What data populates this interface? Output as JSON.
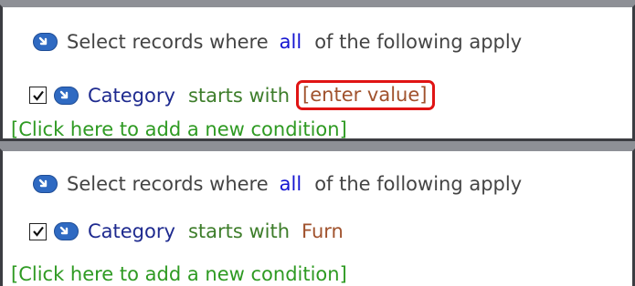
{
  "filters": [
    {
      "intro_before": "Select records where",
      "quantifier": "all",
      "intro_after": "of the following apply",
      "condition": {
        "checked": true,
        "field": "Category",
        "operator": "starts with",
        "value": "[enter value]",
        "highlighted": true
      },
      "add_condition_label": "[Click here to add a new condition]"
    },
    {
      "intro_before": "Select records where",
      "quantifier": "all",
      "intro_after": "of the following apply",
      "condition": {
        "checked": true,
        "field": "Category",
        "operator": "starts with",
        "value": "Furn",
        "highlighted": false
      },
      "add_condition_label": "[Click here to add a new condition]"
    }
  ],
  "icons": {
    "group_toggle": "collapse-arrow-icon",
    "condition_toggle": "collapse-arrow-icon",
    "checkbox": "checkbox-checked-icon"
  },
  "colors": {
    "highlight_border": "#e01414",
    "field": "#1e2a8f",
    "operator": "#3d7d2a",
    "value": "#a0522d",
    "add_link": "#2e9a22",
    "quantifier": "#1515d1"
  }
}
